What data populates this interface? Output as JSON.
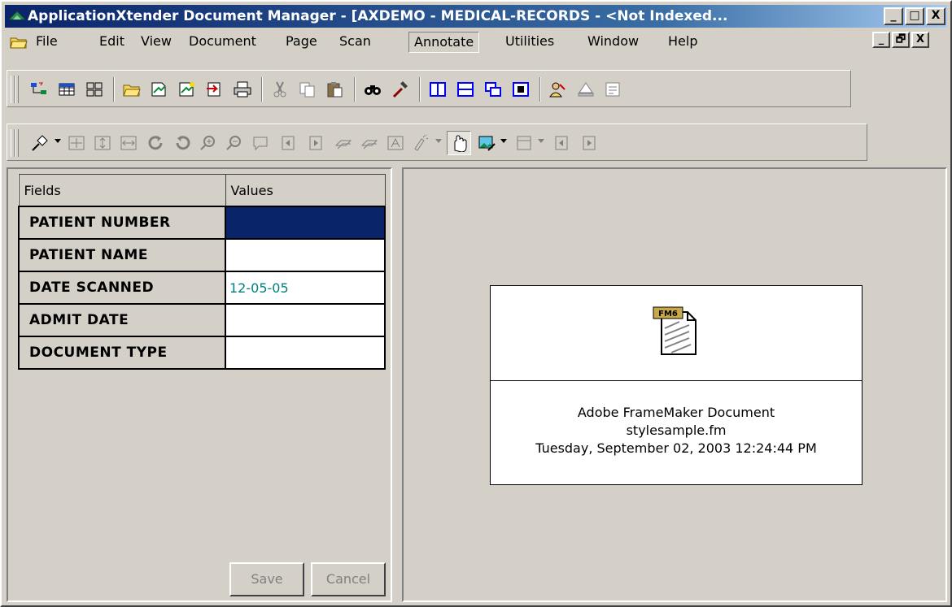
{
  "window": {
    "title": "ApplicationXtender Document Manager - [AXDEMO - MEDICAL-RECORDS - <Not Indexed...",
    "app_icon": "axtender-triangle-icon",
    "caption_buttons": [
      "_",
      "□",
      "X"
    ]
  },
  "menubar": {
    "items": [
      "File",
      "Edit",
      "View",
      "Document",
      "Page",
      "Scan",
      "Annotate",
      "Utilities",
      "Window",
      "Help"
    ],
    "active": "Annotate",
    "mdi_buttons": [
      "_",
      "🗗",
      "X"
    ]
  },
  "toolbar1": {
    "icons": [
      "tree-icon",
      "thumbnail-grid-icon",
      "cascade-icon",
      "open-folder-icon",
      "scan-icon",
      "rescan-icon",
      "import-icon",
      "print-icon",
      "cut-icon",
      "copy-icon",
      "paste-icon",
      "find-icon",
      "tools-icon",
      "split-vertical-icon",
      "split-horizontal-icon",
      "windows-icon",
      "fit-icon",
      "users-icon",
      "stamp-icon",
      "notes-icon"
    ]
  },
  "toolbar2": {
    "icons": [
      "pin-icon",
      "zoom-fit-icon",
      "fit-height-icon",
      "fit-width-icon",
      "rotate-left-icon",
      "rotate-right-icon",
      "zoom-in-icon",
      "zoom-out-icon",
      "note-icon",
      "first-page-icon",
      "last-page-icon",
      "link-icon",
      "link2-icon",
      "text-annotation-icon",
      "highlight-icon",
      "hand-icon",
      "image-edit-icon",
      "page-view-icon",
      "prev-page-icon",
      "next-page-icon"
    ],
    "pressed": [
      "hand-icon"
    ]
  },
  "index_panel": {
    "headers": {
      "fields": "Fields",
      "values": "Values"
    },
    "rows": [
      {
        "field": "PATIENT NUMBER",
        "value": ""
      },
      {
        "field": "PATIENT NAME",
        "value": ""
      },
      {
        "field": "DATE SCANNED",
        "value": "12-05-05"
      },
      {
        "field": "ADMIT DATE",
        "value": ""
      },
      {
        "field": "DOCUMENT TYPE",
        "value": ""
      }
    ],
    "selected_row": 0,
    "save_label": "Save",
    "cancel_label": "Cancel"
  },
  "document_card": {
    "icon": "framemaker-document-icon",
    "icon_badge": "FM6",
    "type_label": "Adobe FrameMaker Document",
    "filename": "stylesample.fm",
    "timestamp": "Tuesday, September 02, 2003 12:24:44 PM"
  },
  "colors": {
    "title_gradient_start": "#0a246a",
    "title_gradient_end": "#a6caf0",
    "selection": "#0a246a",
    "value_text": "#008080",
    "face": "#d4d0c8"
  }
}
